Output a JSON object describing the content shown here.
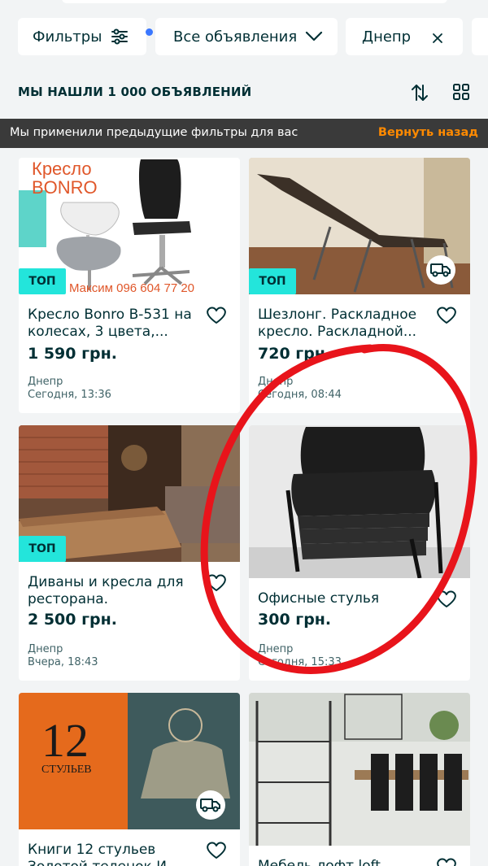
{
  "filters": {
    "filters_label": "Фильтры",
    "all_ads_label": "Все объявления",
    "city_label": "Днепр"
  },
  "results": {
    "title": "МЫ НАШЛИ 1 000 ОБЪЯВЛЕНИЙ"
  },
  "notice": {
    "text": "Мы применили предыдущие фильтры для вас",
    "revert_label": "Вернуть назад"
  },
  "listings": [
    {
      "title": "Кресло Bonro B-531 на колесах, 3 цвета,...",
      "price": "1 590 грн.",
      "location": "Днепр",
      "date": "Сегодня, 13:36",
      "badge": "ТОП",
      "photo_text": [
        "Кресло",
        "BONRO",
        "Максим 096 604 77 20"
      ]
    },
    {
      "title": "Шезлонг. Раскладное кресло. Раскладной...",
      "price": "720 грн.",
      "location": "Днепр",
      "date": "Сегодня, 08:44",
      "badge": "ТОП"
    },
    {
      "title": "Диваны и кресла для ресторана.",
      "price": "2 500 грн.",
      "location": "Днепр",
      "date": "Вчера, 18:43",
      "badge": "ТОП"
    },
    {
      "title": "Офисные стулья",
      "price": "300 грн.",
      "location": "Днепр",
      "date": "Сегодня, 15:33"
    },
    {
      "title": "Книги 12 стульев Золотой теленок И...",
      "photo_text": [
        "12",
        "СТУЛЬЕВ"
      ]
    },
    {
      "title": "Мебель лофт loft..."
    }
  ],
  "colors": {
    "accent_badge": "#23e5db",
    "notice_link": "#ff8a00",
    "annotation": "#e8141b",
    "filter_dot": "#3a77ff"
  },
  "icons": [
    "sliders-icon",
    "chevron-down-icon",
    "close-icon",
    "sort-icon",
    "grid-view-icon",
    "heart-icon",
    "delivery-truck-icon"
  ]
}
